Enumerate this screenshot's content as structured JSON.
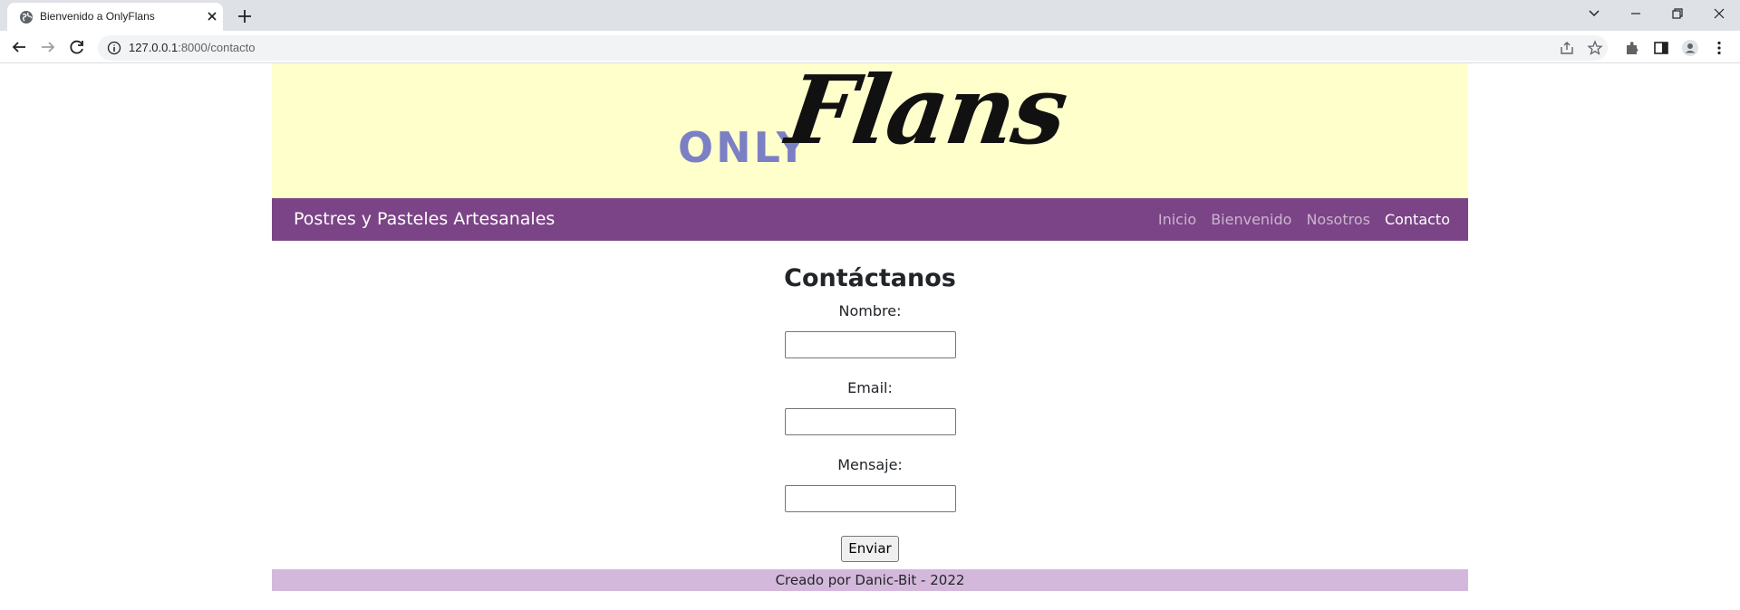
{
  "browser": {
    "tab_title": "Bienvenido a OnlyFlans",
    "url_host": "127.0.0.1",
    "url_path": ":8000/contacto"
  },
  "site": {
    "logo_prefix": "ONLY",
    "logo_name": "Flans",
    "brand": "Postres y Pasteles Artesanales",
    "nav": [
      {
        "label": "Inicio"
      },
      {
        "label": "Bienvenido"
      },
      {
        "label": "Nosotros"
      },
      {
        "label": "Contacto"
      }
    ],
    "active_nav": "Contacto",
    "colors": {
      "banner": "#ffffcc",
      "navbar": "#7b4486",
      "footer": "#d4b8dc",
      "logo_prefix": "#7b7fc4"
    }
  },
  "contact": {
    "heading": "Contáctanos",
    "name_label": "Nombre:",
    "name_value": "",
    "email_label": "Email:",
    "email_value": "",
    "message_label": "Mensaje:",
    "message_value": "",
    "submit": "Enviar"
  },
  "footer": {
    "text": "Creado por Danic-Bit - 2022"
  }
}
